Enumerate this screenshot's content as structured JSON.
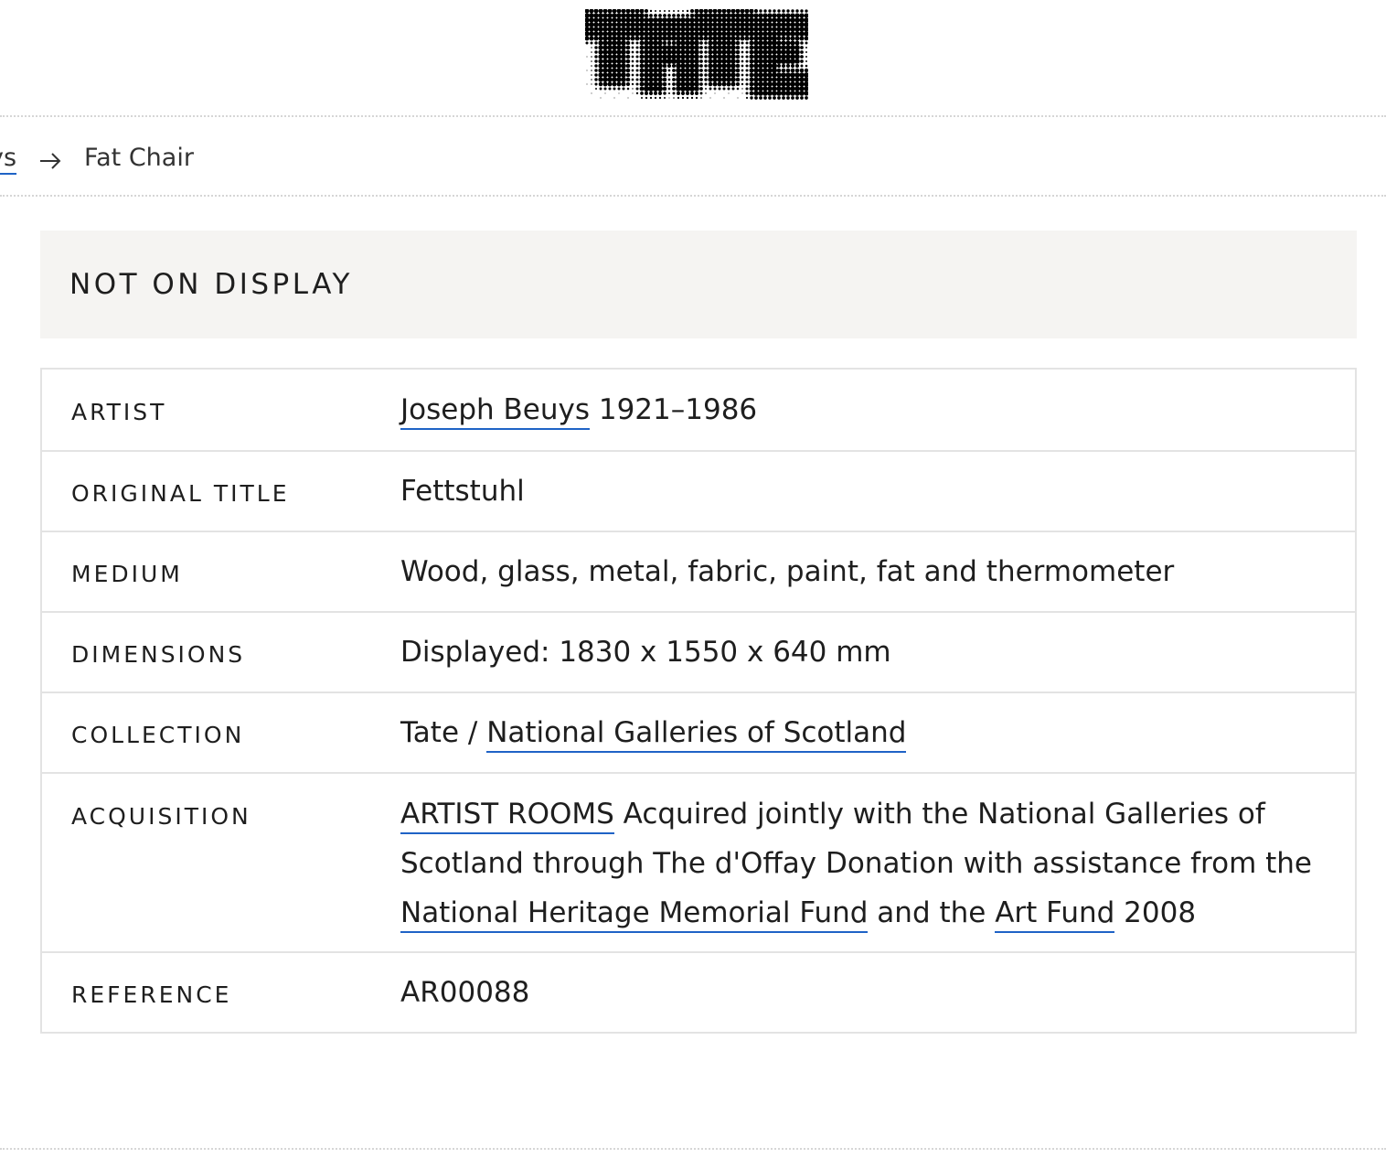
{
  "header": {
    "logo_text": "TATE"
  },
  "breadcrumb": {
    "previous": "ys",
    "current": "Fat Chair"
  },
  "display_status": "NOT ON DISPLAY",
  "details": {
    "artist": {
      "label": "ARTIST",
      "name": "Joseph Beuys",
      "dates": "1921–1986"
    },
    "original_title": {
      "label": "ORIGINAL TITLE",
      "value": "Fettstuhl"
    },
    "medium": {
      "label": "MEDIUM",
      "value": "Wood, glass, metal, fabric, paint, fat and thermometer"
    },
    "dimensions": {
      "label": "DIMENSIONS",
      "value": "Displayed: 1830 x 1550 x 640 mm"
    },
    "collection": {
      "label": "COLLECTION",
      "prefix": "Tate / ",
      "link": "National Galleries of Scotland"
    },
    "acquisition": {
      "label": "ACQUISITION",
      "link1": "ARTIST ROOMS",
      "text1": " Acquired jointly with the National Galleries of Scotland through The d'Offay Donation with assistance from the ",
      "link2": "National Heritage Memorial Fund",
      "text2": " and the ",
      "link3": "Art Fund",
      "text3": " 2008"
    },
    "reference": {
      "label": "REFERENCE",
      "value": "AR00088"
    }
  },
  "colors": {
    "link_underline": "#1f63c6",
    "status_background": "#f5f4f2",
    "table_border": "#e3e3e3",
    "text": "#1e1e1e"
  }
}
